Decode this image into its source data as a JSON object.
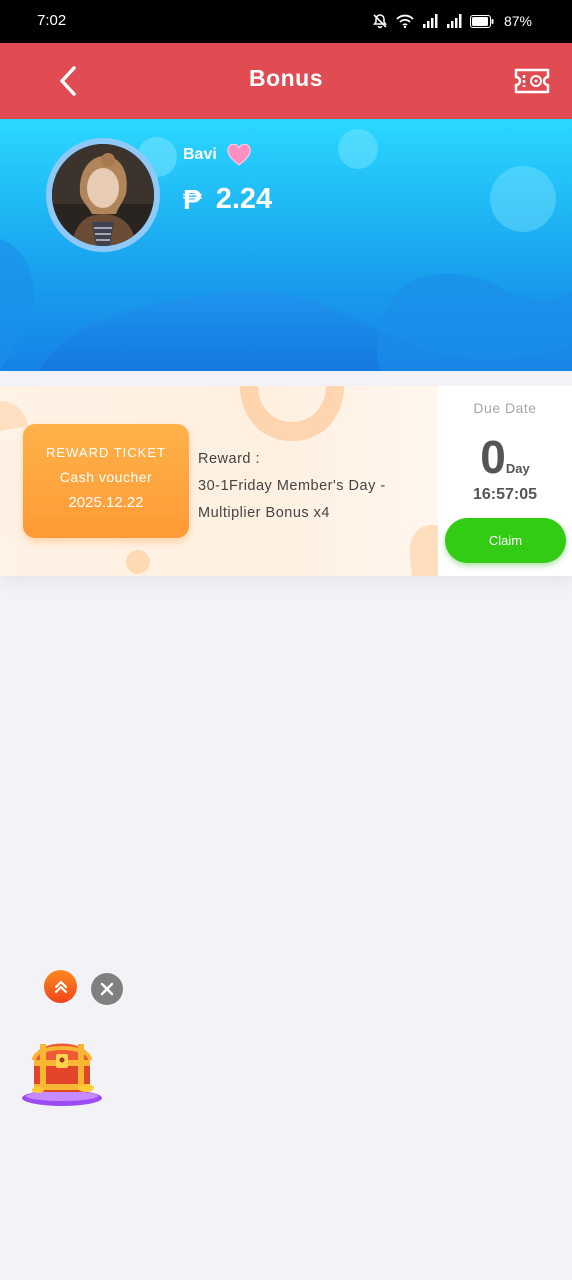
{
  "status_bar": {
    "time": "7:02",
    "battery": "87%"
  },
  "header": {
    "title": "Bonus",
    "back_icon": "chevron-left-icon",
    "right_icon": "ticket-icon"
  },
  "profile": {
    "username": "Bavi",
    "currency_symbol": "₱",
    "balance": "2.24"
  },
  "reward_card": {
    "ticket_title": "REWARD TICKET",
    "ticket_type": "Cash voucher",
    "ticket_date": "2025.12.22",
    "reward_label": "Reward :",
    "reward_desc": "30-1Friday Member's Day - Multiplier Bonus x4",
    "due_label": "Due Date",
    "due_days": "0",
    "due_day_unit": "Day",
    "due_time": "16:57:05",
    "claim_label": "Claim"
  },
  "colors": {
    "header": "#e04c52",
    "claim": "#33cc14",
    "ticket": "#ffa03c",
    "banner": "#1aa6ef"
  }
}
